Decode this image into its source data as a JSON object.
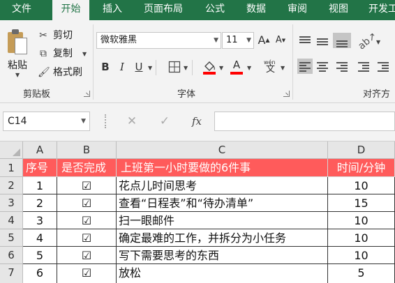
{
  "menu": {
    "tabs": [
      {
        "label": "文件"
      },
      {
        "label": "开始"
      },
      {
        "label": "插入"
      },
      {
        "label": "页面布局"
      },
      {
        "label": "公式"
      },
      {
        "label": "数据"
      },
      {
        "label": "审阅"
      },
      {
        "label": "视图"
      },
      {
        "label": "开发工"
      }
    ],
    "active_tab": "开始"
  },
  "ribbon": {
    "clipboard": {
      "paste_label": "粘贴",
      "cut_label": "剪切",
      "copy_label": "复制",
      "format_painter_label": "格式刷",
      "group_label": "剪贴板"
    },
    "font": {
      "font_name": "微软雅黑",
      "font_size": "11",
      "grow_icon": "A",
      "shrink_icon": "A",
      "bold": "B",
      "italic": "I",
      "underline": "U",
      "font_color_icon": "A",
      "phonetic_top": "wén",
      "phonetic_bottom": "文",
      "group_label": "字体"
    },
    "alignment": {
      "group_label": "对齐方"
    }
  },
  "formula_bar": {
    "name_box": "C14",
    "cancel_icon": "✕",
    "enter_icon": "✓",
    "fx_label": "fx",
    "formula": ""
  },
  "sheet": {
    "columns": [
      "A",
      "B",
      "C",
      "D"
    ],
    "row_numbers": [
      "1",
      "2",
      "3",
      "4",
      "5",
      "6",
      "7"
    ],
    "header_row": [
      "序号",
      "是否完成",
      "上班第一小时要做的6件事",
      "时间/分钟"
    ],
    "rows": [
      [
        "1",
        "☑",
        "花点儿时间思考",
        "10"
      ],
      [
        "2",
        "☑",
        "查看“日程表”和“待办清单”",
        "15"
      ],
      [
        "3",
        "☑",
        "扫一眼邮件",
        "10"
      ],
      [
        "4",
        "☑",
        "确定最难的工作，并拆分为小任务",
        "10"
      ],
      [
        "5",
        "☑",
        "写下需要思考的东西",
        "10"
      ],
      [
        "6",
        "☑",
        "放松",
        "5"
      ]
    ]
  },
  "colors": {
    "menu_bar": "#227447",
    "header_fill": "#ff5b5b",
    "ribbon_bg": "#f3f3f3"
  }
}
